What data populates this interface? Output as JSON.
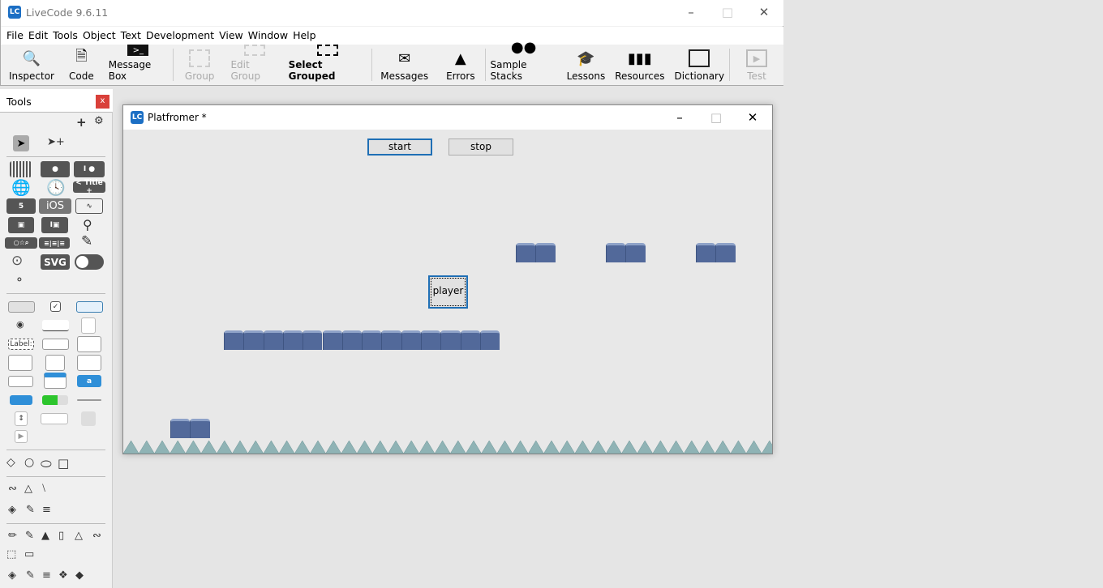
{
  "main_window": {
    "title": "LiveCode 9.6.11",
    "logo": "LC",
    "menus": [
      "File",
      "Edit",
      "Tools",
      "Object",
      "Text",
      "Development",
      "View",
      "Window",
      "Help"
    ],
    "toolbar": [
      {
        "label": "Inspector",
        "icon": "inspector-icon",
        "enabled": true
      },
      {
        "label": "Code",
        "icon": "code-icon",
        "enabled": true
      },
      {
        "label": "Message Box",
        "icon": "message-box-icon",
        "enabled": true
      },
      {
        "label": "Group",
        "icon": "group-icon",
        "enabled": false
      },
      {
        "label": "Edit Group",
        "icon": "edit-group-icon",
        "enabled": false
      },
      {
        "label": "Select Grouped",
        "icon": "select-grouped-icon",
        "enabled": true
      },
      {
        "label": "Messages",
        "icon": "envelope-icon",
        "enabled": true
      },
      {
        "label": "Errors",
        "icon": "warning-icon",
        "enabled": true
      },
      {
        "label": "Sample Stacks",
        "icon": "people-icon",
        "enabled": true
      },
      {
        "label": "Lessons",
        "icon": "mortarboard-icon",
        "enabled": true
      },
      {
        "label": "Resources",
        "icon": "books-icon",
        "enabled": true
      },
      {
        "label": "Dictionary",
        "icon": "dictionary-icon",
        "enabled": true
      },
      {
        "label": "Test",
        "icon": "play-icon",
        "enabled": false
      }
    ]
  },
  "tools_palette": {
    "title": "Tools",
    "close": "x",
    "title_widget": "< Title +",
    "ios": "iOS",
    "svg": "SVG",
    "label_widget": "Label:"
  },
  "stack_window": {
    "title": "Platfromer *",
    "start_label": "start",
    "stop_label": "stop",
    "player_label": "player"
  }
}
